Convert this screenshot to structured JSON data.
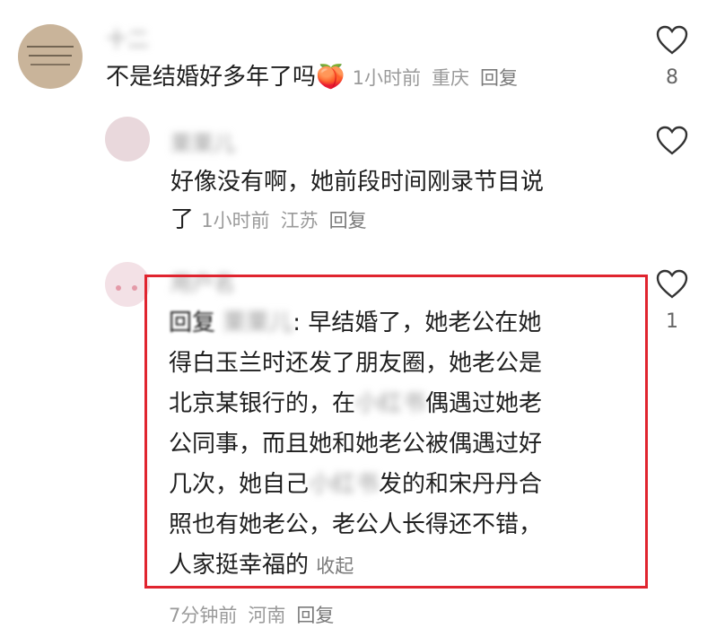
{
  "comments": [
    {
      "username": "十二",
      "text": "不是结婚好多年了吗",
      "emoji": "🍑",
      "time": "1小时前",
      "location": "重庆",
      "reply_label": "回复",
      "likes": "8"
    },
    {
      "username": "栗栗儿",
      "text_line1": "好像没有啊，她前段时间刚录节目说",
      "text_line2": "了",
      "time": "1小时前",
      "location": "江苏",
      "reply_label": "回复",
      "likes": ""
    },
    {
      "username": "用户名",
      "reply_prefix": "回复",
      "reply_to": "栗栗儿",
      "lines": [
        ": 早结婚了，她老公在她",
        "得白玉兰时还发了朋友圈，她老公是",
        "北京某银行的，在",
        "偶遇过她老",
        "公同事，而且她和她老公被偶遇过好",
        "几次，她自己",
        "发的和宋丹丹合",
        "照也有她老公，老公人长得还不错，",
        "人家挺幸福的"
      ],
      "blur_word1": "小红书",
      "blur_word2": "小红书",
      "collapse_label": "收起",
      "time": "7分钟前",
      "location": "河南",
      "reply_label": "回复",
      "likes": "1"
    }
  ],
  "colors": {
    "highlight_border": "#e0242f",
    "meta_text": "#9a9a9a"
  }
}
